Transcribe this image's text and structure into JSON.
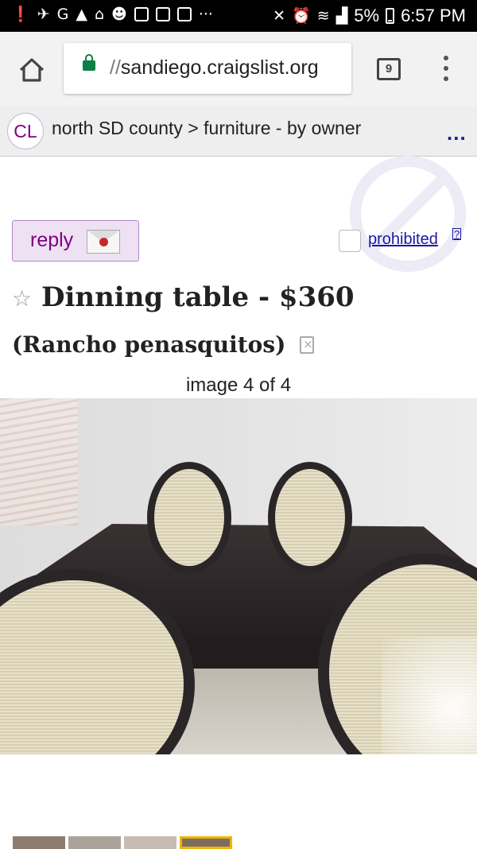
{
  "status_bar": {
    "left_icons": [
      "alert-icon",
      "run-icon",
      "google-icon",
      "arrow-icon",
      "home-icon",
      "robot-icon",
      "facebook-icon",
      "facebook-icon",
      "image-icon",
      "more-icon"
    ],
    "battery": "5%",
    "time": "6:57 PM"
  },
  "browser": {
    "url_scheme": "//",
    "url_host": "sandiego.craigslist.org",
    "tab_count": "9"
  },
  "header": {
    "logo": "CL",
    "breadcrumb": "north SD county > furniture - by owner",
    "more": "..."
  },
  "posting": {
    "reply_label": "reply",
    "prohibited_label": "prohibited",
    "help_label": "?",
    "title": "Dinning table",
    "price": "$360",
    "location": "(Rancho penasquitos)",
    "image_counter": "image 4 of 4"
  },
  "thumbnails": {
    "count": 4,
    "selected_index": 4
  },
  "colors": {
    "accent_purple": "#800080",
    "link_blue": "#1a1aa6",
    "secure_green": "#0b8043"
  }
}
